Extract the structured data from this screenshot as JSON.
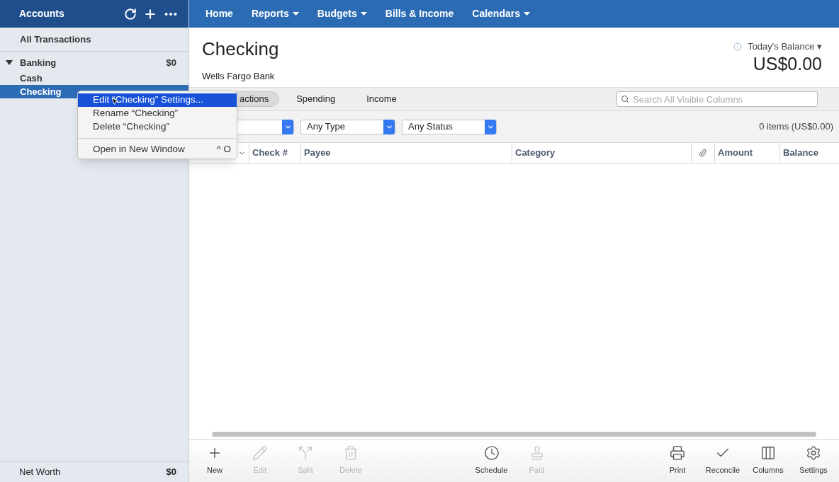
{
  "sidebar": {
    "title": "Accounts",
    "all_transactions": "All Transactions",
    "groups": [
      {
        "name": "Banking",
        "total": "$0",
        "expanded": true,
        "accounts": [
          {
            "name": "Cash",
            "selected": false
          },
          {
            "name": "Checking",
            "selected": true
          }
        ]
      }
    ],
    "footer": {
      "label": "Net Worth",
      "value": "$0"
    }
  },
  "nav": [
    {
      "label": "Home",
      "dropdown": false
    },
    {
      "label": "Reports",
      "dropdown": true
    },
    {
      "label": "Budgets",
      "dropdown": true
    },
    {
      "label": "Bills & Income",
      "dropdown": false
    },
    {
      "label": "Calendars",
      "dropdown": true
    }
  ],
  "account": {
    "title": "Checking",
    "bank": "Wells Fargo Bank",
    "balance_label": "Today's Balance ▾",
    "balance": "US$0.00"
  },
  "tabs": [
    {
      "label": "actions",
      "selected": true
    },
    {
      "label": "Spending",
      "selected": false
    },
    {
      "label": "Income",
      "selected": false
    }
  ],
  "search": {
    "placeholder": "Search All Visible Columns"
  },
  "filters": [
    {
      "value": "Any Type"
    },
    {
      "value": "Any Status"
    }
  ],
  "item_count": "0 items (US$0.00)",
  "columns": [
    {
      "kind": "sort"
    },
    {
      "label": "Check #",
      "kind": "text"
    },
    {
      "label": "Payee",
      "kind": "text"
    },
    {
      "label": "Category",
      "kind": "text"
    },
    {
      "kind": "attachment"
    },
    {
      "label": "Amount",
      "kind": "text"
    },
    {
      "label": "Balance",
      "kind": "text"
    }
  ],
  "toolbar": [
    {
      "label": "New",
      "disabled": false
    },
    {
      "label": "Edit",
      "disabled": true
    },
    {
      "label": "Split",
      "disabled": true
    },
    {
      "label": "Delete",
      "disabled": true
    },
    {
      "label": "Schedule",
      "disabled": false
    },
    {
      "label": "Paid",
      "disabled": true
    },
    {
      "label": "Print",
      "disabled": false
    },
    {
      "label": "Reconcile",
      "disabled": false
    },
    {
      "label": "Columns",
      "disabled": false
    },
    {
      "label": "Settings",
      "disabled": false
    }
  ],
  "context_menu": [
    {
      "label": "Edit “Checking” Settings...",
      "selected": true,
      "kind": "item"
    },
    {
      "label": "Rename “Checking”",
      "selected": false,
      "kind": "item"
    },
    {
      "label": "Delete “Checking”",
      "selected": false,
      "kind": "item"
    },
    {
      "kind": "separator"
    },
    {
      "label": "Open in New Window",
      "shortcut": "^ O",
      "selected": false,
      "kind": "item"
    }
  ]
}
